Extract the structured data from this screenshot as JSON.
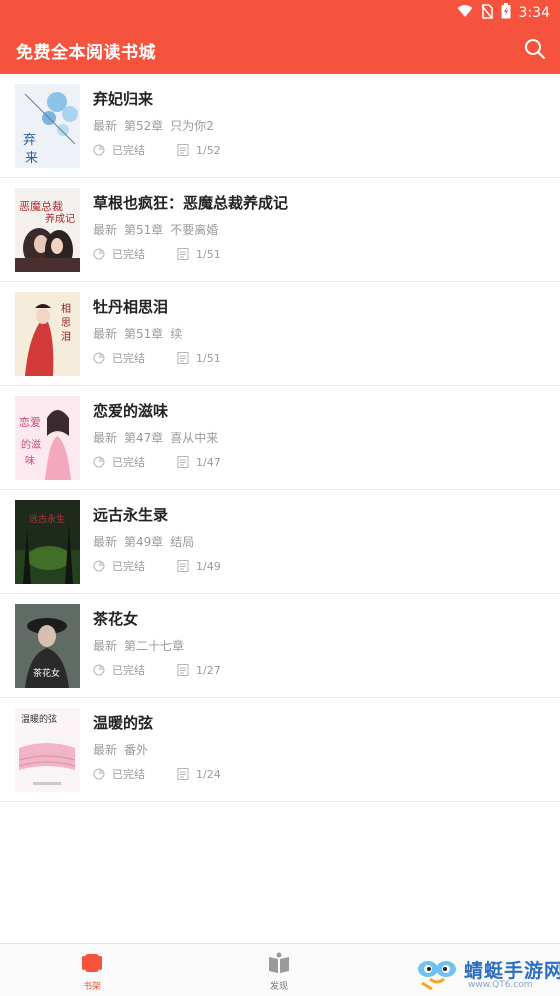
{
  "statusbar": {
    "time": "3:34",
    "icons": [
      "wifi-icon",
      "no-sim-icon",
      "battery-icon"
    ]
  },
  "appbar": {
    "title": "免费全本阅读书城",
    "search_icon": "search-icon"
  },
  "books": [
    {
      "title": "弃妃归来",
      "latest_label": "最新",
      "chapter": "第52章",
      "chapter_title": "只为你2",
      "status": "已完结",
      "progress": "1/52"
    },
    {
      "title": "草根也疯狂：恶魔总裁养成记",
      "latest_label": "最新",
      "chapter": "第51章",
      "chapter_title": "不要离婚",
      "status": "已完结",
      "progress": "1/51"
    },
    {
      "title": "牡丹相思泪",
      "latest_label": "最新",
      "chapter": "第51章",
      "chapter_title": "续",
      "status": "已完结",
      "progress": "1/51"
    },
    {
      "title": "恋爱的滋味",
      "latest_label": "最新",
      "chapter": "第47章",
      "chapter_title": "喜从中来",
      "status": "已完结",
      "progress": "1/47"
    },
    {
      "title": "远古永生录",
      "latest_label": "最新",
      "chapter": "第49章",
      "chapter_title": "结局",
      "status": "已完结",
      "progress": "1/49"
    },
    {
      "title": "茶花女",
      "latest_label": "最新",
      "chapter": "第二十七章",
      "chapter_title": "",
      "status": "已完结",
      "progress": "1/27"
    },
    {
      "title": "温暖的弦",
      "latest_label": "最新",
      "chapter": "番外",
      "chapter_title": "",
      "status": "已完结",
      "progress": "1/24"
    }
  ],
  "tabs": [
    {
      "label": "书架",
      "active": true
    },
    {
      "label": "发现",
      "active": false
    }
  ],
  "watermark": {
    "brand": "蜻蜓手游网",
    "url": "www.QT6.com"
  },
  "colors": {
    "accent": "#f5533d",
    "muted": "#9a9a9a",
    "title": "#222222"
  }
}
